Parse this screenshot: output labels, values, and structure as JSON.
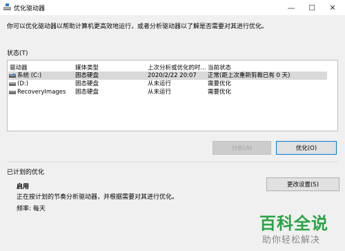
{
  "window": {
    "title": "优化驱动器",
    "min_glyph": "—",
    "max_glyph": "☐",
    "close_glyph": "✕"
  },
  "description": "你可以优化驱动器以帮助计算机更高效地运行，或者分析驱动器以了解是否需要对其进行优化。",
  "status_label": "状态(T)",
  "table": {
    "columns": [
      "驱动器",
      "媒体类型",
      "上次分析或优化的时...",
      "当前状态"
    ],
    "rows": [
      {
        "drive": "系统 (C:)",
        "media": "固态硬盘",
        "last": "2020/2/22 20:07",
        "status": "正常(距上次重新剪裁已有 0 天)",
        "icon": "system-drive-icon",
        "selected": true
      },
      {
        "drive": "(D:)",
        "media": "固态硬盘",
        "last": "从未运行",
        "status": "需要优化",
        "icon": "drive-icon",
        "selected": false
      },
      {
        "drive": "RecoveryImages",
        "media": "固态硬盘",
        "last": "从未运行",
        "status": "需要优化",
        "icon": "drive-icon",
        "selected": false
      }
    ]
  },
  "buttons": {
    "analyze": "分析(A)",
    "optimize": "优化(O)",
    "change_settings": "更改设置(S)"
  },
  "scheduled": {
    "label": "已计划的优化",
    "state": "启用",
    "description": "正在按计划的节奏分析驱动器，并根据需要对其进行优化。",
    "frequency": "频率: 每天"
  },
  "watermark": {
    "main": "百科全说",
    "sub": "助你轻松解决"
  },
  "colors": {
    "selected_row": "#d9d9d9",
    "accent": "#0078d7",
    "watermark_green": "#2aa345"
  }
}
